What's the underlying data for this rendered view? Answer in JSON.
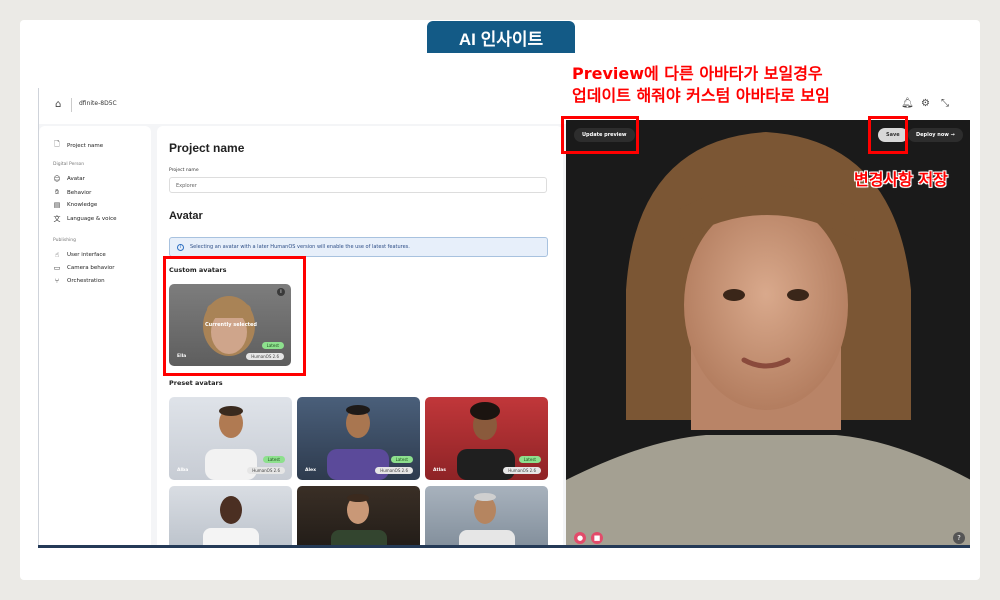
{
  "header_tag": "AI 인사이트",
  "topbar": {
    "org": "dfinite-8D5C"
  },
  "sidebar": {
    "project": "Project name",
    "section_digital": "Digital Person",
    "items_digital": [
      "Avatar",
      "Behavior",
      "Knowledge",
      "Language & voice"
    ],
    "section_publishing": "Publishing",
    "items_publishing": [
      "User interface",
      "Camera behavior",
      "Orchestration"
    ]
  },
  "main": {
    "title": "Project name",
    "field_label": "Project name",
    "field_value": "Explorer",
    "avatar_heading": "Avatar",
    "info_text": "Selecting an avatar with a later HumanOS version will enable the use of latest features.",
    "custom_heading": "Custom avatars",
    "custom_avatar": {
      "name": "Ella",
      "overlay": "Currently selected",
      "badge": "Latest",
      "version": "HumanOS 2.6"
    },
    "preset_heading": "Preset avatars",
    "presets": [
      {
        "name": "Alba",
        "badge": "Latest",
        "version": "HumanOS 2.6"
      },
      {
        "name": "Alex",
        "badge": "Latest",
        "version": "HumanOS 2.6"
      },
      {
        "name": "Atlas",
        "badge": "Latest",
        "version": "HumanOS 2.6"
      }
    ]
  },
  "preview": {
    "update_btn": "Update preview",
    "save_btn": "Save",
    "deploy_btn": "Deploy now →"
  },
  "annotations": {
    "preview_note_line1": "Preview에 다른 아바타가 보일경우",
    "preview_note_line2": "업데이트 해줘야 커스텀 아바타로 보임",
    "save_note": "변경사항 저장"
  },
  "colors": {
    "accent_tag": "#135a86",
    "annotation": "#ff0000",
    "info_bg": "#e7effa",
    "latest_badge": "#8de08d"
  }
}
